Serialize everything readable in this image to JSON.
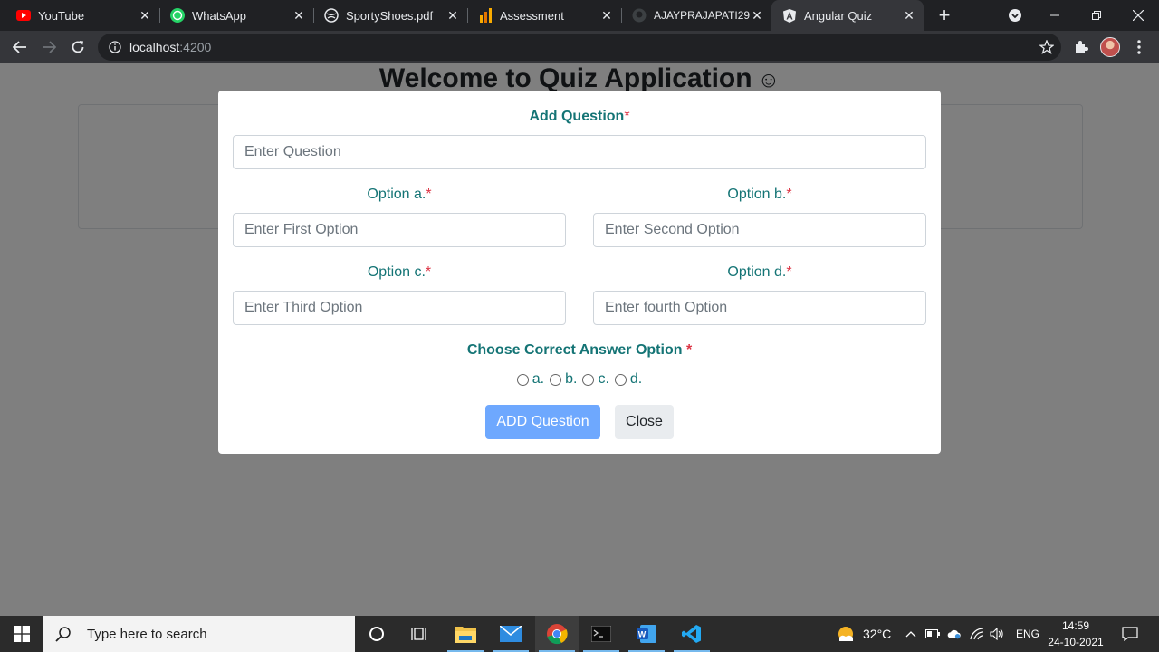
{
  "browser": {
    "tabs": [
      {
        "title": "YouTube",
        "icon": "youtube-icon"
      },
      {
        "title": "WhatsApp",
        "icon": "whatsapp-icon"
      },
      {
        "title": "SportyShoes.pdf",
        "icon": "globe-icon"
      },
      {
        "title": "Assessment",
        "icon": "analytics-icon"
      },
      {
        "title": "AJAYPRAJAPATI291",
        "icon": "github-icon"
      },
      {
        "title": "Angular Quiz",
        "icon": "angular-icon"
      }
    ],
    "active_tab_index": 5,
    "url_host": "localhost",
    "url_port": ":4200"
  },
  "page": {
    "heading": "Welcome to Quiz Application",
    "heading_emoji": "☺"
  },
  "modal": {
    "question_label": "Add Question",
    "question_placeholder": "Enter Question",
    "option_a_label": "Option a.",
    "option_a_placeholder": "Enter First Option",
    "option_b_label": "Option b.",
    "option_b_placeholder": "Enter Second Option",
    "option_c_label": "Option c.",
    "option_c_placeholder": "Enter Third Option",
    "option_d_label": "Option d.",
    "option_d_placeholder": "Enter fourth Option",
    "required_marker": "*",
    "answer_label": "Choose Correct Answer Option",
    "answer_options": [
      "a.",
      "b.",
      "c.",
      "d."
    ],
    "add_button": "ADD Question",
    "close_button": "Close"
  },
  "taskbar": {
    "search_placeholder": "Type here to search",
    "weather": "32°C",
    "language": "ENG",
    "time": "14:59",
    "date": "24-10-2021"
  },
  "colors": {
    "label_teal": "#147475",
    "required_red": "#dc3545",
    "add_button": "#6ea8fe",
    "taskbar_accent": "#76b9ed"
  }
}
